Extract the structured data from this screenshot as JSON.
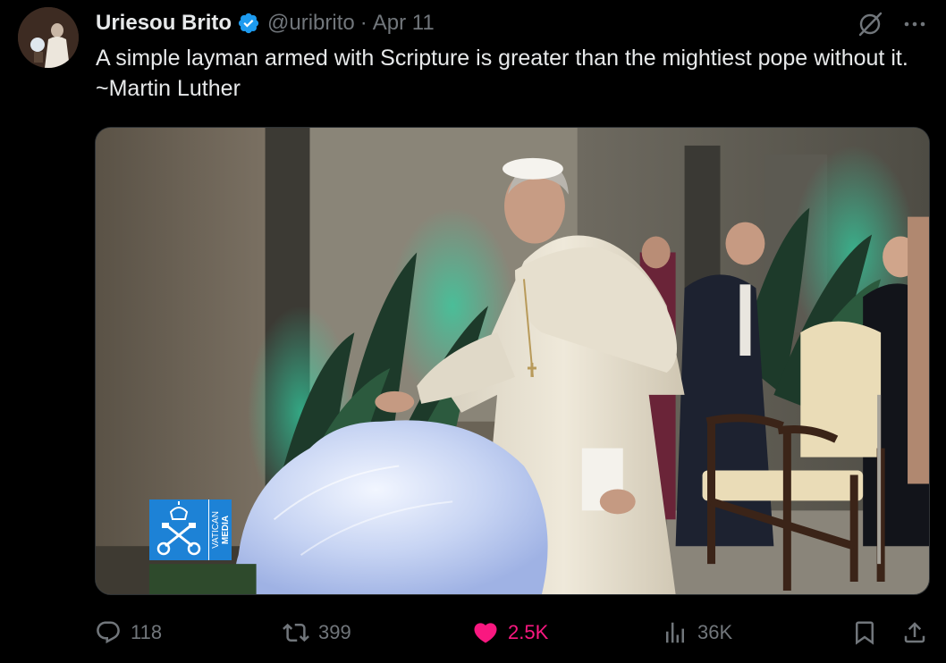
{
  "author": {
    "display_name": "Uriesou Brito",
    "handle": "@uribrito",
    "separator": "·",
    "date": "Apr 11",
    "verified": true
  },
  "tweet": {
    "text": "A simple layman armed with Scripture is greater than the mightiest pope without it. ~Martin Luther"
  },
  "media": {
    "watermark_line1": "VATICAN",
    "watermark_line2": "MEDIA"
  },
  "actions": {
    "replies": "118",
    "reposts": "399",
    "likes": "2.5K",
    "views": "36K"
  },
  "icons": {
    "verified": "verified-badge-icon",
    "grok": "grok-icon",
    "more": "more-options-icon",
    "reply": "reply-icon",
    "repost": "repost-icon",
    "like": "heart-icon",
    "views": "views-icon",
    "bookmark": "bookmark-icon",
    "share": "share-icon"
  },
  "colors": {
    "background": "#000000",
    "text_primary": "#e7e9ea",
    "text_secondary": "#71767b",
    "verified_blue": "#1d9bf0",
    "like_pink": "#f91880",
    "vatican_blue": "#1d82d6"
  }
}
